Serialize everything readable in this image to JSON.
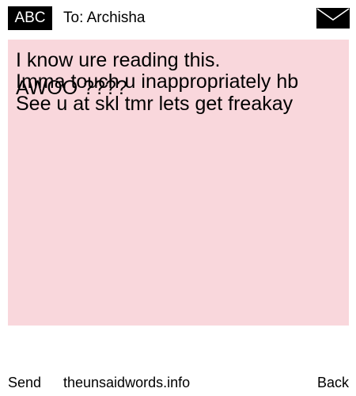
{
  "header": {
    "logo_text": "ABC",
    "recipient_label": "To: Archisha",
    "mail_icon": "envelope-icon"
  },
  "message": {
    "background_color": "#f9d7dc",
    "lines": [
      "I know ure reading this.",
      "Imma touch u inappropriately hb",
      "AWOO ????",
      "See u at skl tmr lets get freakay"
    ]
  },
  "footer": {
    "send_label": "Send",
    "site_label": "theunsaidwords.info",
    "back_label": "Back"
  }
}
